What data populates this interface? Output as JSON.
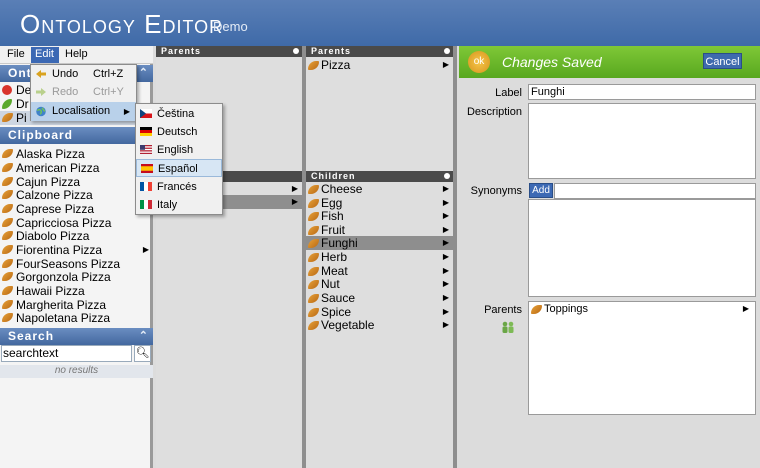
{
  "header": {
    "title": "Ontology Editor",
    "subtitle": "Demo"
  },
  "menubar": {
    "file": "File",
    "edit": "Edit",
    "help": "Help"
  },
  "edit_menu": {
    "undo": {
      "label": "Undo",
      "shortcut": "Ctrl+Z"
    },
    "redo": {
      "label": "Redo",
      "shortcut": "Ctrl+Y"
    },
    "localisation": {
      "label": "Localisation"
    }
  },
  "languages": [
    "Čeština",
    "Deutsch",
    "English",
    "Español",
    "Francés",
    "Italy"
  ],
  "selected_language": "Español",
  "ontologies": {
    "title": "Ont",
    "items": [
      "De",
      "Dr",
      "Pi"
    ]
  },
  "clipboard": {
    "title": "Clipboard",
    "items": [
      "Alaska Pizza",
      "American Pizza",
      "Cajun Pizza",
      "Calzone Pizza",
      "Caprese Pizza",
      "Capricciosa Pizza",
      "Diabolo Pizza",
      "Fiorentina Pizza",
      "FourSeasons Pizza",
      "Gorgonzola Pizza",
      "Hawaii Pizza",
      "Margherita Pizza",
      "Napoletana Pizza"
    ]
  },
  "search": {
    "title": "Search",
    "value": "searchtext",
    "status": "no results"
  },
  "col1": {
    "parents_title": "Parents"
  },
  "col2": {
    "parents_title": "Parents",
    "parents": [
      "Pizza"
    ],
    "children_title": "Children",
    "children": [
      "Cheese",
      "Egg",
      "Fish",
      "Fruit",
      "Funghi",
      "Herb",
      "Meat",
      "Nut",
      "Sauce",
      "Spice",
      "Vegetable"
    ],
    "selected": "Funghi"
  },
  "detail": {
    "ok_badge": "ok",
    "status": "Changes Saved",
    "cancel_label": "Cancel",
    "label_label": "Label",
    "label_value": "Funghi",
    "description_label": "Description",
    "description_value": "",
    "synonyms_label": "Synonyms",
    "add_label": "Add",
    "parents_label": "Parents",
    "parents": [
      "Toppings"
    ]
  },
  "colors": {
    "header": "#4a73ae",
    "accent": "#3c69b4",
    "save_bar": "#6bbb2b",
    "leaf": "#d48a2a"
  }
}
